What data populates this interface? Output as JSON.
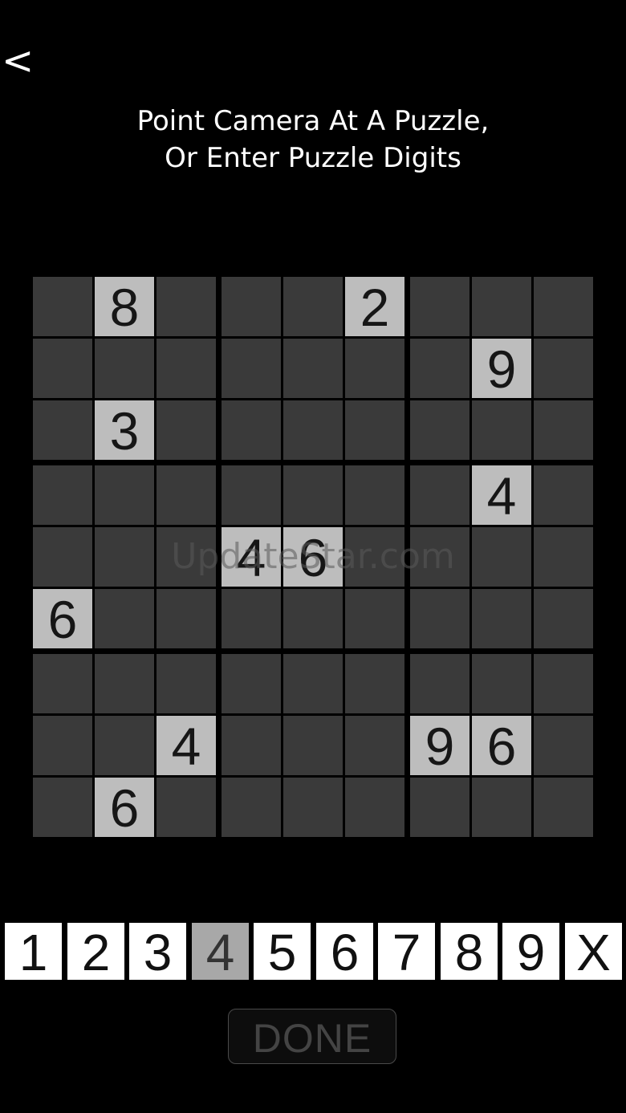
{
  "header": {
    "back_label": "<",
    "instructions_line1": "Point Camera At A Puzzle,",
    "instructions_line2": "Or Enter Puzzle Digits"
  },
  "board": {
    "cells": [
      [
        "",
        "8",
        "",
        "",
        "",
        "2",
        "",
        "",
        ""
      ],
      [
        "",
        "",
        "",
        "",
        "",
        "",
        "",
        "9",
        ""
      ],
      [
        "",
        "3",
        "",
        "",
        "",
        "",
        "",
        "",
        ""
      ],
      [
        "",
        "",
        "",
        "",
        "",
        "",
        "",
        "4",
        ""
      ],
      [
        "",
        "",
        "",
        "4",
        "6",
        "",
        "",
        "",
        ""
      ],
      [
        "6",
        "",
        "",
        "",
        "",
        "",
        "",
        "",
        ""
      ],
      [
        "",
        "",
        "",
        "",
        "",
        "",
        "",
        "",
        ""
      ],
      [
        "",
        "",
        "4",
        "",
        "",
        "",
        "9",
        "6",
        ""
      ],
      [
        "",
        "6",
        "",
        "",
        "",
        "",
        "",
        "",
        ""
      ]
    ]
  },
  "watermark": "UpdateStar.com",
  "number_pad": {
    "keys": [
      "1",
      "2",
      "3",
      "4",
      "5",
      "6",
      "7",
      "8",
      "9",
      "X"
    ],
    "selected": "4"
  },
  "done_label": "DONE",
  "colors": {
    "background": "#000000",
    "empty_cell": "#3a3a3a",
    "given_cell": "#bdbdbd",
    "pad_key": "#ffffff",
    "pad_key_selected": "#a8a8a8"
  }
}
